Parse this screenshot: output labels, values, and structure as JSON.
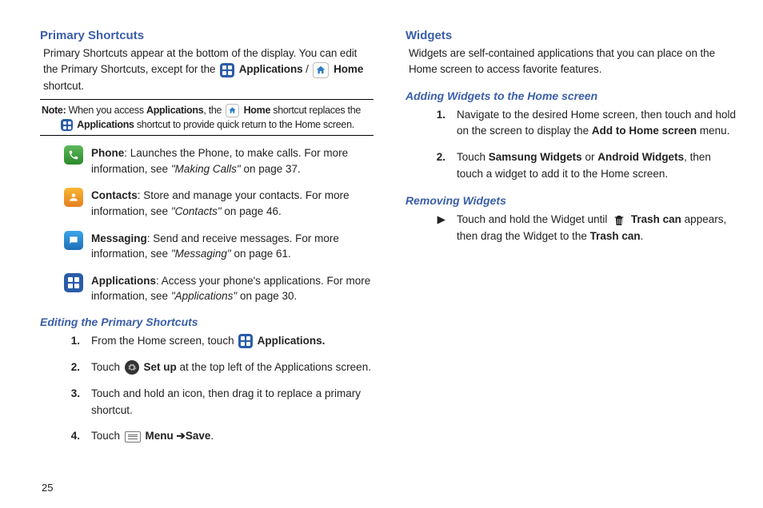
{
  "left": {
    "h1": "Primary Shortcuts",
    "intro_a": "Primary Shortcuts appear at the bottom of the display. You can edit the Primary Shortcuts, except for the ",
    "intro_apps": " Applications",
    "intro_slash": " / ",
    "intro_home": " Home",
    "intro_b": " shortcut.",
    "note_prefix": "Note:",
    "note_a": " When you access ",
    "note_apps": "Applications",
    "note_b": ", the ",
    "note_home": " Home",
    "note_c": " shortcut replaces the",
    "note_line2_apps": " Applications",
    "note_line2_rest": " shortcut to provide quick return to the Home screen.",
    "phone_t": "Phone",
    "phone_a": ": Launches the Phone, to make calls. For more information, see ",
    "phone_ref": "\"Making Calls\"",
    "phone_b": " on page 37.",
    "contacts_t": "Contacts",
    "contacts_a": ": Store and manage your contacts. For more information, see ",
    "contacts_ref": "\"Contacts\"",
    "contacts_b": " on page 46.",
    "msg_t": "Messaging",
    "msg_a": ": Send and receive messages. For more information, see ",
    "msg_ref": "\"Messaging\"",
    "msg_b": " on page 61.",
    "apps_t": "Applications",
    "apps_a": ": Access your phone's applications. For more information, see ",
    "apps_ref": "\"Applications\"",
    "apps_b": " on page 30.",
    "h2_edit": "Editing the Primary Shortcuts",
    "s1_a": "From the Home screen, touch ",
    "s1_b": " Applications.",
    "s2_a": "Touch ",
    "s2_setup": " Set up",
    "s2_b": " at the top left of the Applications screen.",
    "s3": "Touch and hold an icon, then drag it to replace a primary shortcut.",
    "s4_a": "Touch ",
    "s4_menu": " Menu ",
    "s4_arrow": "➔",
    "s4_save": "Save",
    "s4_b": "."
  },
  "right": {
    "h1": "Widgets",
    "intro": "Widgets are self-contained applications that you can place on the Home screen to access favorite features.",
    "h2_add": "Adding Widgets to the Home screen",
    "a1_a": "Navigate to the desired Home screen, then touch and hold on the screen to display the ",
    "a1_bold": "Add to Home screen",
    "a1_b": " menu.",
    "a2_a": "Touch ",
    "a2_sw": "Samsung Widgets",
    "a2_or": "  or ",
    "a2_aw": "Android Widgets",
    "a2_b": ", then touch a widget to add it to the Home screen.",
    "h2_rem": "Removing Widgets",
    "r_a": "Touch and hold the Widget until ",
    "r_trash": " Trash can",
    "r_b": " appears, then drag the Widget to the ",
    "r_trash2": "Trash can",
    "r_c": "."
  },
  "pagenum": "25"
}
